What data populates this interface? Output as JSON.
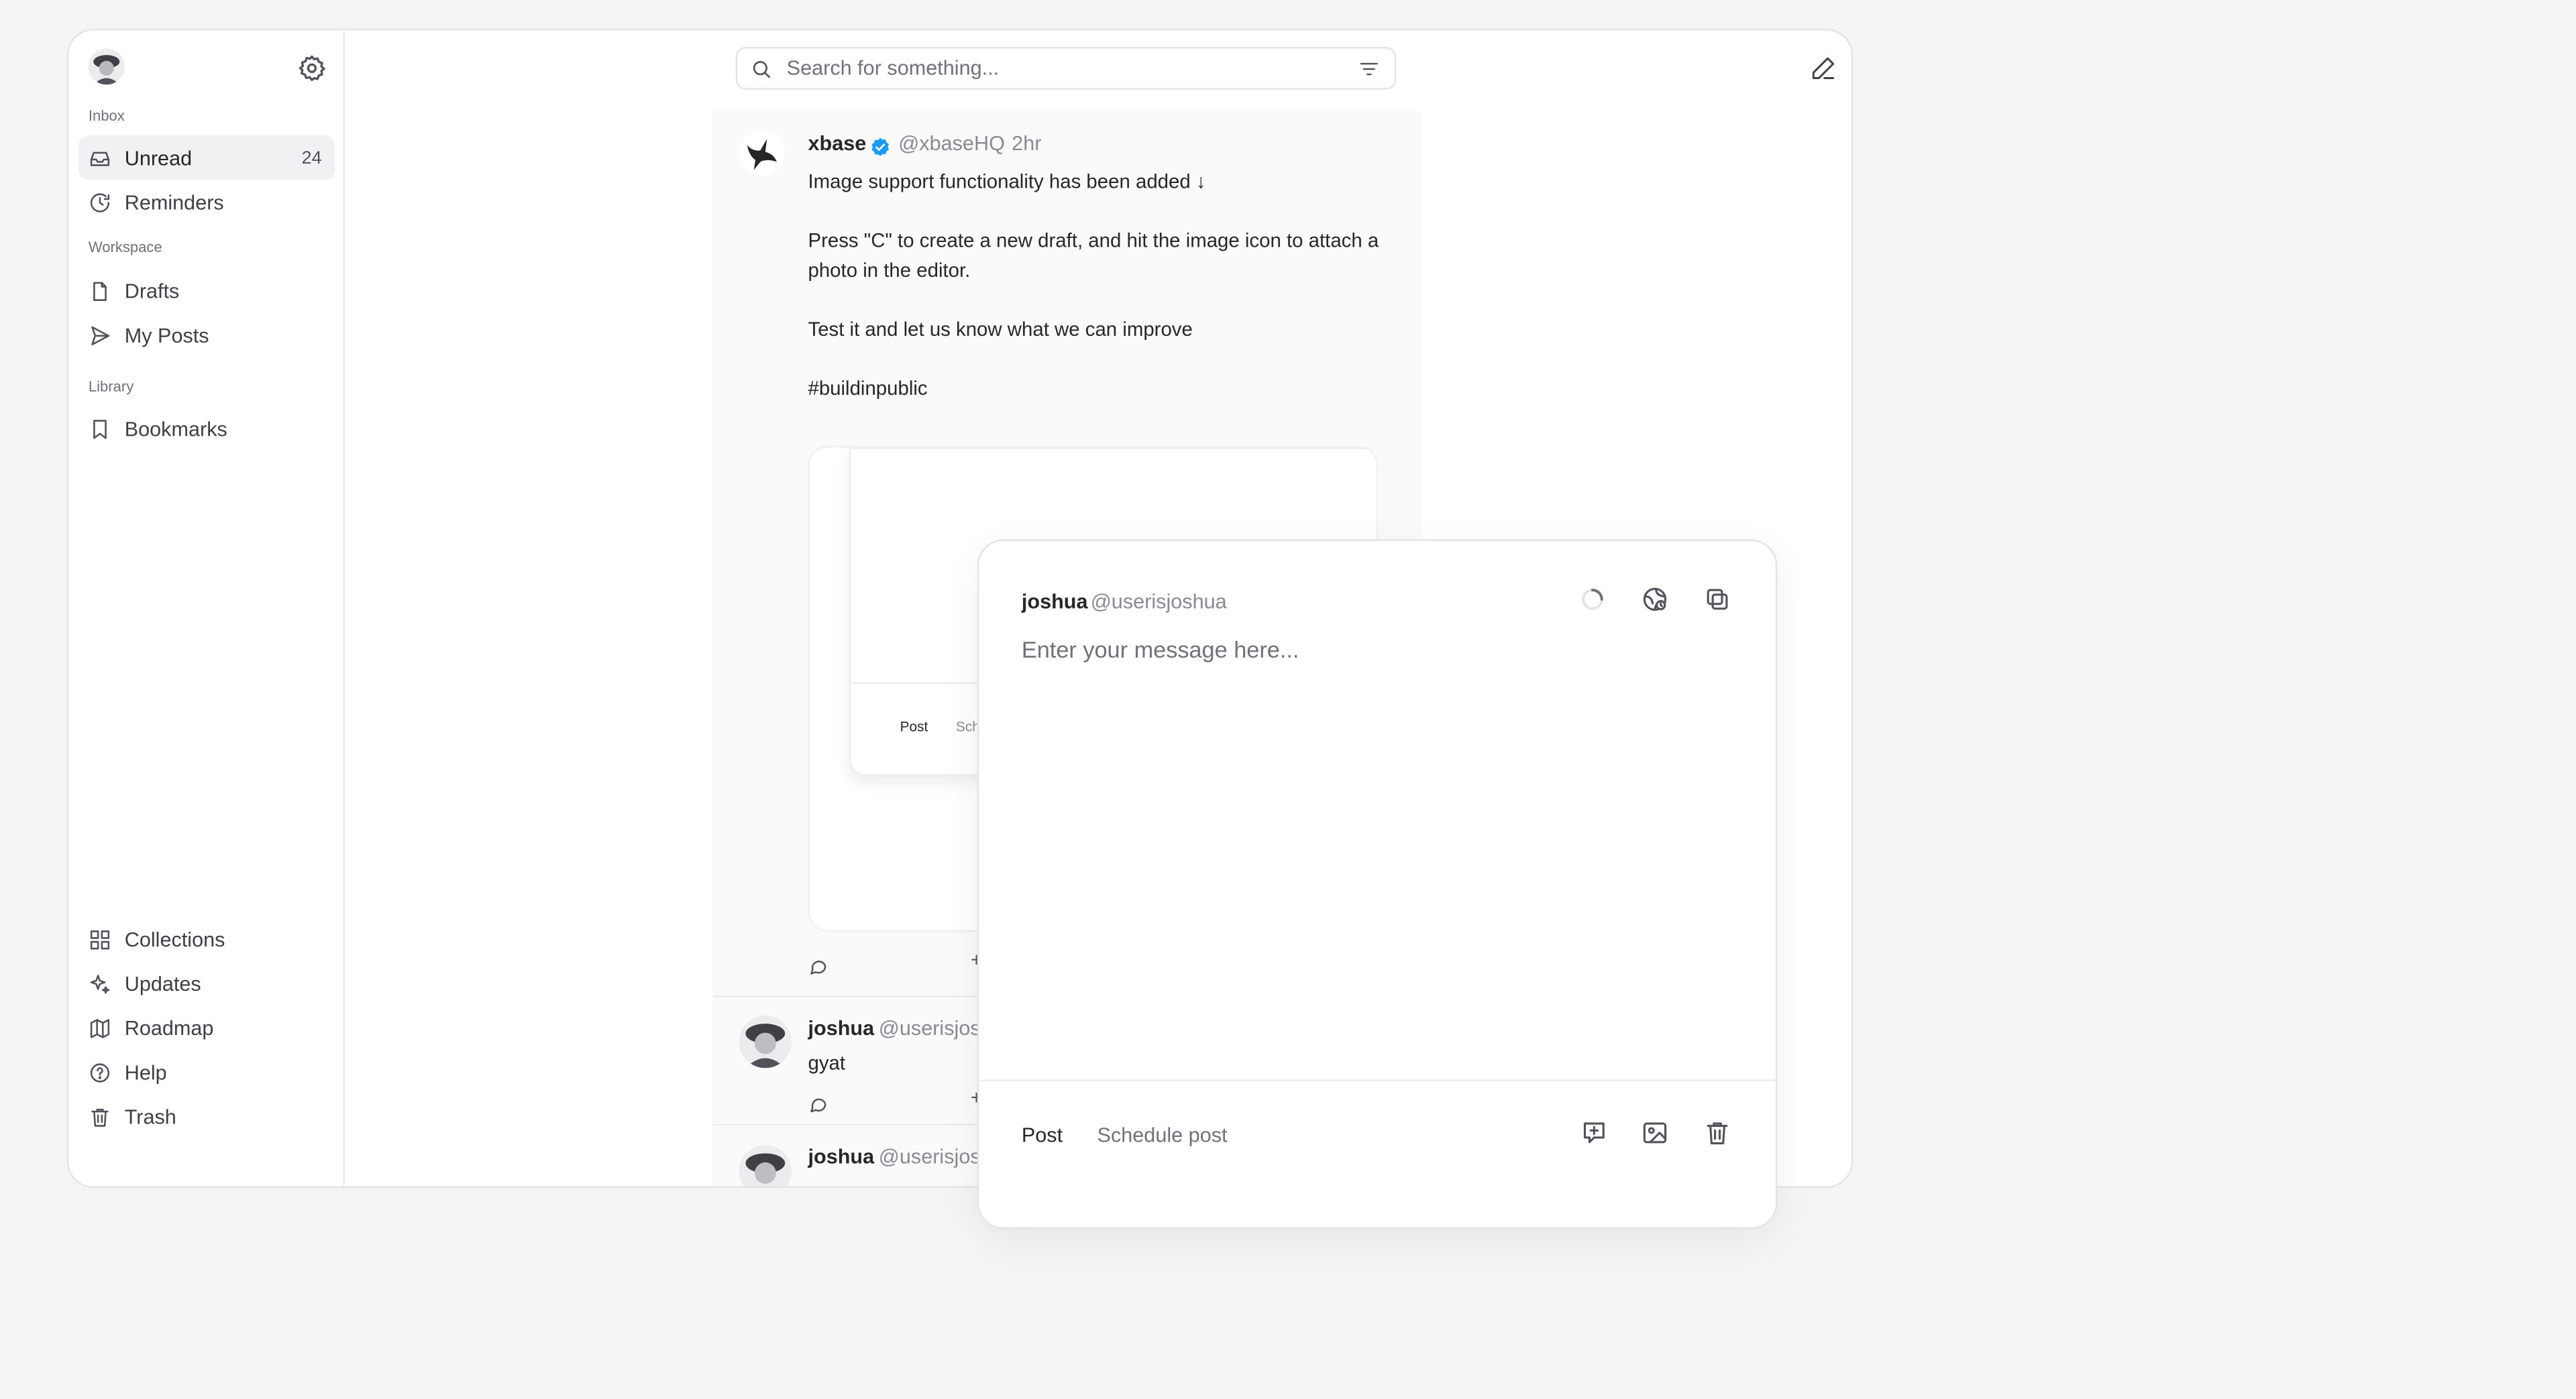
{
  "sidebar": {
    "user_avatar": "user-avatar",
    "settings_icon": "gear-icon",
    "sections": {
      "inbox": "Inbox",
      "workspace": "Workspace",
      "library": "Library"
    },
    "items": [
      {
        "id": "unread",
        "label": "Unread",
        "count": "24",
        "icon": "inbox-icon",
        "active": true
      },
      {
        "id": "reminders",
        "label": "Reminders",
        "icon": "clock-icon"
      },
      {
        "id": "drafts",
        "label": "Drafts",
        "icon": "file-icon"
      },
      {
        "id": "my_posts",
        "label": "My Posts",
        "icon": "send-icon"
      },
      {
        "id": "bookmarks",
        "label": "Bookmarks",
        "icon": "bookmark-icon"
      },
      {
        "id": "collections",
        "label": "Collections",
        "icon": "grid-icon"
      },
      {
        "id": "updates",
        "label": "Updates",
        "icon": "sparkle-icon"
      },
      {
        "id": "roadmap",
        "label": "Roadmap",
        "icon": "map-icon"
      },
      {
        "id": "help",
        "label": "Help",
        "icon": "help-icon"
      },
      {
        "id": "trash",
        "label": "Trash",
        "icon": "trash-icon"
      }
    ]
  },
  "search": {
    "placeholder": "Search for something...",
    "value": ""
  },
  "feed": {
    "posts": [
      {
        "author": "xbase",
        "handle": "@xbaseHQ",
        "time": "2hr",
        "verified": true,
        "paragraphs": [
          "Image support functionality has been added ↓",
          "Press \"C\" to create a new draft, and hit the image icon to attach a photo in the editor.",
          "Test it and let us know what we can improve",
          "#buildinpublic"
        ],
        "image_preview": {
          "post_label": "Post",
          "schedule_label": "Sch"
        }
      },
      {
        "author": "joshua",
        "handle": "@userisjosh",
        "text": "gyat"
      },
      {
        "author": "joshua",
        "handle": "@userisjosh"
      }
    ]
  },
  "composer": {
    "author": "joshua",
    "handle": "@userisjoshua",
    "placeholder": "Enter your message here...",
    "value": "",
    "post_label": "Post",
    "schedule_label": "Schedule post"
  },
  "colors": {
    "verified": "#1d9bf0",
    "background": "#f4f4f4",
    "active_nav": "#f1f1f3"
  }
}
